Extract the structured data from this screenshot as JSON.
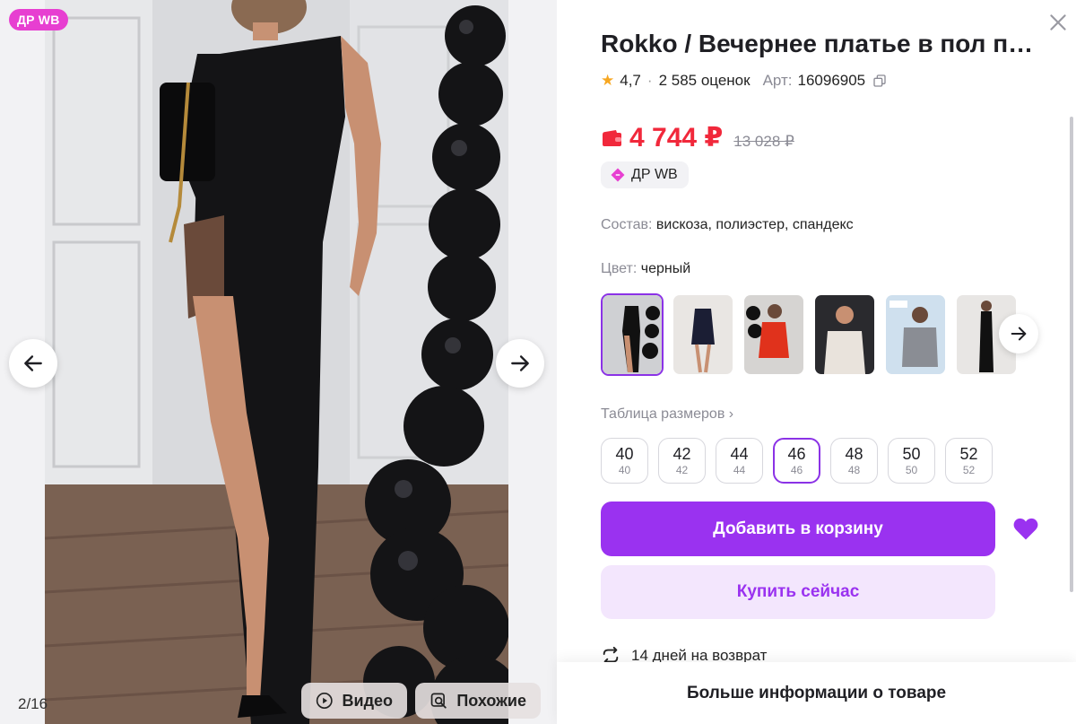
{
  "gallery": {
    "badge": "ДР WB",
    "counter": "2/16",
    "prev_icon": "arrow-left-icon",
    "next_icon": "arrow-right-icon",
    "video_label": "Видео",
    "similar_label": "Похожие"
  },
  "product": {
    "title": "Rokko / Вечернее платье в пол пр…",
    "rating": "4,7",
    "reviews": "2 585 оценок",
    "article_label": "Арт:",
    "article": "16096905",
    "price": "4 744 ₽",
    "old_price": "13 028 ₽",
    "promo_chip": "ДР WB",
    "composition_label": "Состав:",
    "composition": "вискоза, полиэстер, спандекс",
    "color_label": "Цвет:",
    "color": "черный",
    "size_table_label": "Таблица размеров ›",
    "sizes": [
      {
        "main": "40",
        "sub": "40"
      },
      {
        "main": "42",
        "sub": "42"
      },
      {
        "main": "44",
        "sub": "44"
      },
      {
        "main": "46",
        "sub": "46"
      },
      {
        "main": "48",
        "sub": "48"
      },
      {
        "main": "50",
        "sub": "50"
      },
      {
        "main": "52",
        "sub": "52"
      }
    ],
    "selected_size": "46",
    "add_to_cart": "Добавить в корзину",
    "buy_now": "Купить сейчас",
    "returns": "14 дней на возврат",
    "more_info": "Больше информации о товаре"
  },
  "colors": {
    "accent": "#9a32f0",
    "price": "#f1283b",
    "badge": "#e73fd1",
    "star": "#f7a721"
  }
}
